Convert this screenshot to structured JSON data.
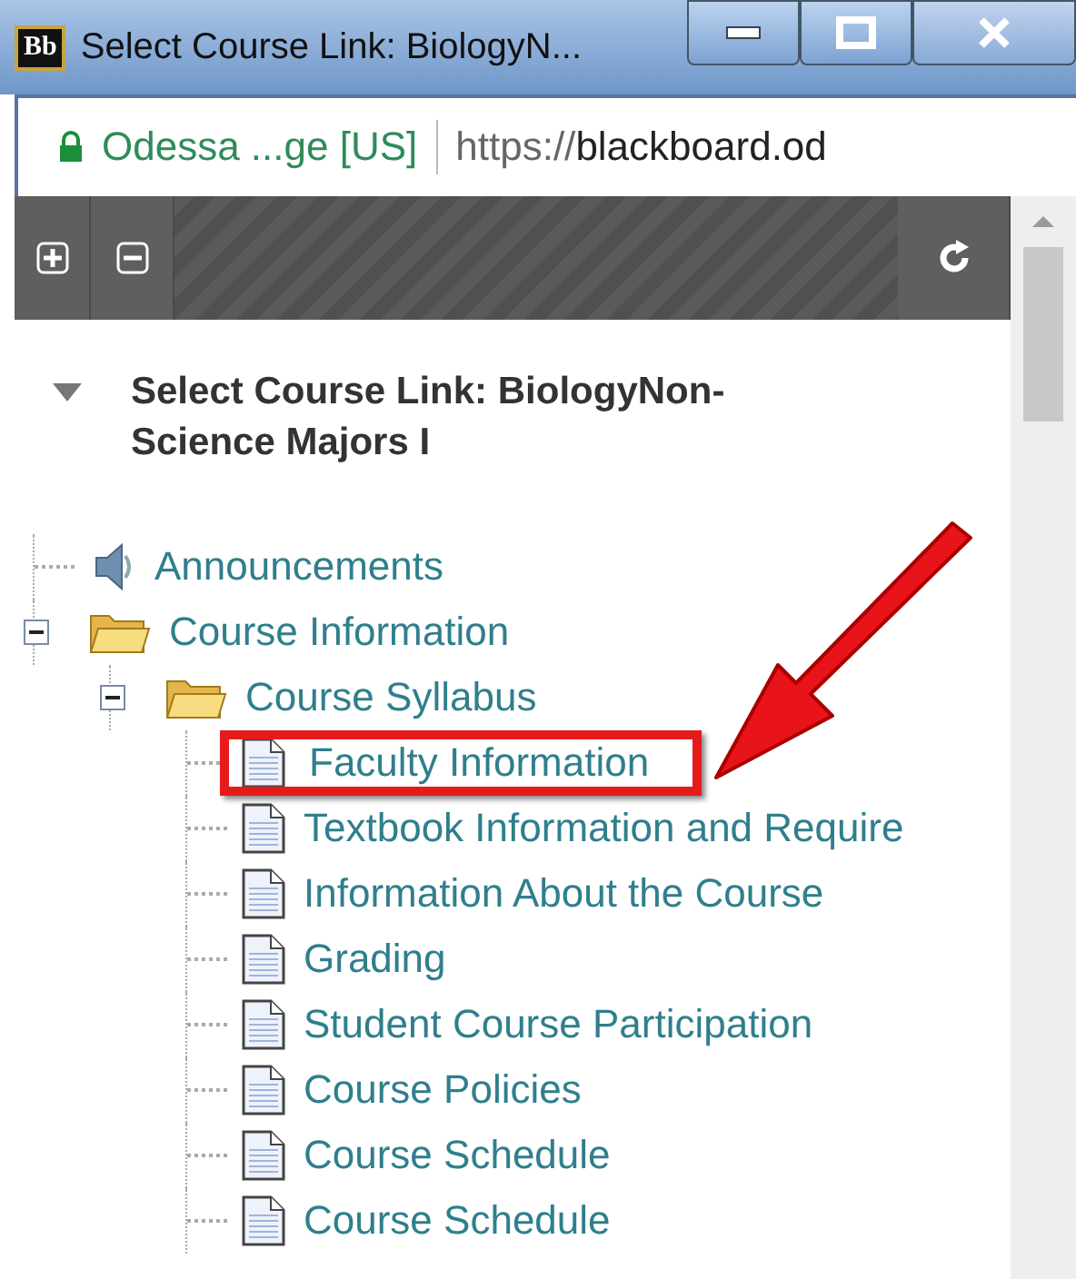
{
  "window": {
    "logo": "Bb",
    "title": "Select Course Link: BiologyN..."
  },
  "address_bar": {
    "site": "Odessa ...ge [US]",
    "scheme": "https://",
    "host": "blackboard.od"
  },
  "heading": {
    "expanded": true,
    "text": "Select Course Link: BiologyNon-Science Majors I"
  },
  "tree": [
    {
      "kind": "announcement",
      "label": "Announcements"
    },
    {
      "kind": "folder",
      "label": "Course Information",
      "expanded": true,
      "children": [
        {
          "kind": "folder",
          "label": "Course Syllabus",
          "expanded": true,
          "children": [
            {
              "kind": "page",
              "label": "Faculty Information",
              "highlighted": true
            },
            {
              "kind": "page",
              "label": "Textbook Information and Require",
              "highlighted": false
            },
            {
              "kind": "page",
              "label": "Information About the Course",
              "highlighted": false
            },
            {
              "kind": "page",
              "label": "Grading",
              "highlighted": false
            },
            {
              "kind": "page",
              "label": "Student Course Participation",
              "highlighted": false
            },
            {
              "kind": "page",
              "label": "Course Policies",
              "highlighted": false
            },
            {
              "kind": "page",
              "label": "Course Schedule",
              "highlighted": false
            },
            {
              "kind": "page",
              "label": "Course Schedule",
              "highlighted": false
            }
          ]
        }
      ]
    }
  ]
}
